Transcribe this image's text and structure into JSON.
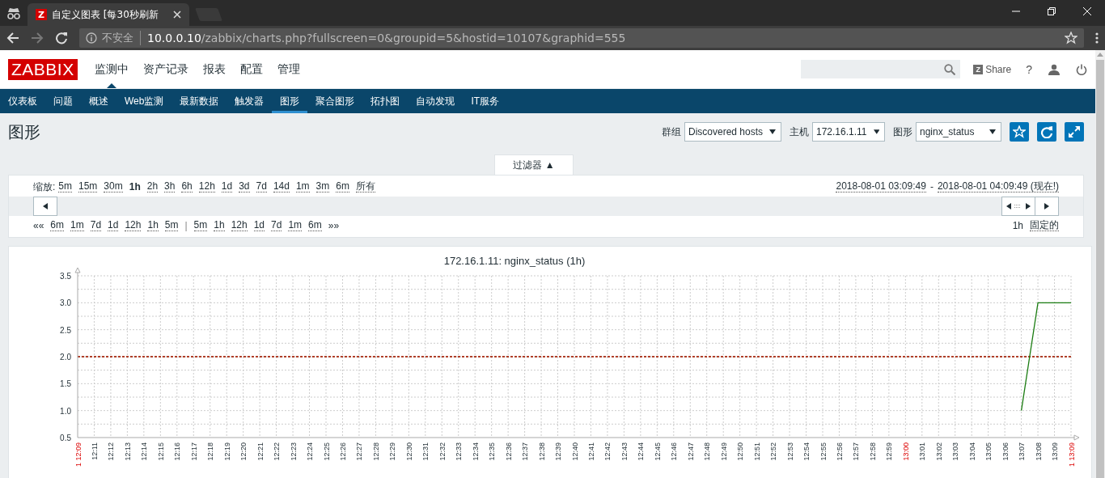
{
  "browser": {
    "tab_favicon": "Z",
    "tab_title": "自定义图表 [每30秒刷新",
    "security": "不安全",
    "url_host": "10.0.0.10",
    "url_path": "/zabbix/charts.php?fullscreen=0&groupid=5&hostid=10107&graphid=555"
  },
  "header": {
    "logo": "ZABBIX",
    "menu": [
      {
        "label": "监测中",
        "selected": true
      },
      {
        "label": "资产记录",
        "selected": false
      },
      {
        "label": "报表",
        "selected": false
      },
      {
        "label": "配置",
        "selected": false
      },
      {
        "label": "管理",
        "selected": false
      }
    ],
    "share_icon": "Z",
    "share": "Share",
    "help": "?"
  },
  "subnav": [
    {
      "label": "仪表板",
      "selected": false
    },
    {
      "label": "问题",
      "selected": false
    },
    {
      "label": "概述",
      "selected": false
    },
    {
      "label": "Web监测",
      "selected": false
    },
    {
      "label": "最新数据",
      "selected": false
    },
    {
      "label": "触发器",
      "selected": false
    },
    {
      "label": "图形",
      "selected": true
    },
    {
      "label": "聚合图形",
      "selected": false
    },
    {
      "label": "拓扑图",
      "selected": false
    },
    {
      "label": "自动发现",
      "selected": false
    },
    {
      "label": "IT服务",
      "selected": false
    }
  ],
  "page": {
    "title": "图形",
    "filters": [
      {
        "label": "群组",
        "value": "Discovered hosts"
      },
      {
        "label": "主机",
        "value": "172.16.1.11"
      },
      {
        "label": "图形",
        "value": "nginx_status"
      }
    ]
  },
  "filter": {
    "tab": "过滤器 ▲",
    "zoom_label": "缩放:",
    "zoom": [
      {
        "label": "5m",
        "selected": false
      },
      {
        "label": "15m",
        "selected": false
      },
      {
        "label": "30m",
        "selected": false
      },
      {
        "label": "1h",
        "selected": true
      },
      {
        "label": "2h",
        "selected": false
      },
      {
        "label": "3h",
        "selected": false
      },
      {
        "label": "6h",
        "selected": false
      },
      {
        "label": "12h",
        "selected": false
      },
      {
        "label": "1d",
        "selected": false
      },
      {
        "label": "3d",
        "selected": false
      },
      {
        "label": "7d",
        "selected": false
      },
      {
        "label": "14d",
        "selected": false
      },
      {
        "label": "1m",
        "selected": false
      },
      {
        "label": "3m",
        "selected": false
      },
      {
        "label": "6m",
        "selected": false
      },
      {
        "label": "所有",
        "selected": false
      }
    ],
    "range_from": "2018-08-01 03:09:49",
    "range_sep": "-",
    "range_to": "2018-08-01 04:09:49 (现在!)",
    "back_mark": "««",
    "back": [
      "6m",
      "1m",
      "7d",
      "1d",
      "12h",
      "1h",
      "5m"
    ],
    "divider": "|",
    "forward": [
      "5m",
      "1h",
      "12h",
      "1d",
      "7d",
      "1m",
      "6m"
    ],
    "forward_mark": "»»",
    "period": "1h",
    "fixed": "固定的"
  },
  "graph": {
    "category_highlight": [
      true,
      false,
      false,
      false,
      false,
      false,
      false,
      false,
      false,
      false,
      false,
      false,
      false,
      false,
      false,
      false,
      false,
      false,
      false,
      false,
      false,
      false,
      false,
      false,
      false,
      false,
      false,
      false,
      false,
      false,
      false,
      false,
      false,
      false,
      false,
      false,
      false,
      false,
      false,
      false,
      false,
      false,
      false,
      false,
      false,
      false,
      false,
      false,
      false,
      false,
      true,
      false,
      false,
      false,
      false,
      false,
      false,
      false,
      false,
      false,
      true
    ],
    "chart_data": {
      "type": "line",
      "title": "172.16.1.11: nginx_status (1h)",
      "grid": true,
      "ylim": [
        0.5,
        3.5
      ],
      "yticks": [
        {
          "value": 0.5,
          "label": "0.5"
        },
        {
          "value": 1.0,
          "label": "1.0"
        },
        {
          "value": 1.5,
          "label": "1.5"
        },
        {
          "value": 2.0,
          "label": "2.0"
        },
        {
          "value": 2.5,
          "label": "2.5"
        },
        {
          "value": 3.0,
          "label": "3.0"
        },
        {
          "value": 3.5,
          "label": "3.5"
        }
      ],
      "categories": [
        "1 12:09",
        "12:11",
        "12:12",
        "12:13",
        "12:14",
        "12:15",
        "12:16",
        "12:17",
        "12:18",
        "12:19",
        "12:20",
        "12:21",
        "12:22",
        "12:23",
        "12:24",
        "12:25",
        "12:26",
        "12:27",
        "12:28",
        "12:29",
        "12:30",
        "12:31",
        "12:32",
        "12:33",
        "12:34",
        "12:35",
        "12:36",
        "12:37",
        "12:38",
        "12:39",
        "12:40",
        "12:41",
        "12:42",
        "12:43",
        "12:44",
        "12:45",
        "12:46",
        "12:47",
        "12:48",
        "12:49",
        "12:50",
        "12:51",
        "12:52",
        "12:53",
        "12:54",
        "12:55",
        "12:56",
        "12:57",
        "12:58",
        "12:59",
        "13:00",
        "13:01",
        "13:02",
        "13:03",
        "13:04",
        "13:05",
        "13:06",
        "13:07",
        "13:08",
        "13:09",
        "1 13:09"
      ],
      "series": [
        {
          "color": "#b0402a",
          "line_style": "dashed",
          "values": [
            2.0,
            2.0,
            2.0,
            2.0,
            2.0,
            2.0,
            2.0,
            2.0,
            2.0,
            2.0,
            2.0,
            2.0,
            2.0,
            2.0,
            2.0,
            2.0,
            2.0,
            2.0,
            2.0,
            2.0,
            2.0,
            2.0,
            2.0,
            2.0,
            2.0,
            2.0,
            2.0,
            2.0,
            2.0,
            2.0,
            2.0,
            2.0,
            2.0,
            2.0,
            2.0,
            2.0,
            2.0,
            2.0,
            2.0,
            2.0,
            2.0,
            2.0,
            2.0,
            2.0,
            2.0,
            2.0,
            2.0,
            2.0,
            2.0,
            2.0,
            2.0,
            2.0,
            2.0,
            2.0,
            2.0,
            2.0,
            2.0,
            2.0,
            2.0,
            2.0,
            2.0
          ]
        },
        {
          "color": "#1a7c11",
          "values": [
            null,
            null,
            null,
            null,
            null,
            null,
            null,
            null,
            null,
            null,
            null,
            null,
            null,
            null,
            null,
            null,
            null,
            null,
            null,
            null,
            null,
            null,
            null,
            null,
            null,
            null,
            null,
            null,
            null,
            null,
            null,
            null,
            null,
            null,
            null,
            null,
            null,
            null,
            null,
            null,
            null,
            null,
            null,
            null,
            null,
            null,
            null,
            null,
            null,
            null,
            null,
            null,
            null,
            null,
            null,
            null,
            null,
            1.0,
            3.0,
            3.0,
            3.0
          ]
        }
      ]
    }
  }
}
